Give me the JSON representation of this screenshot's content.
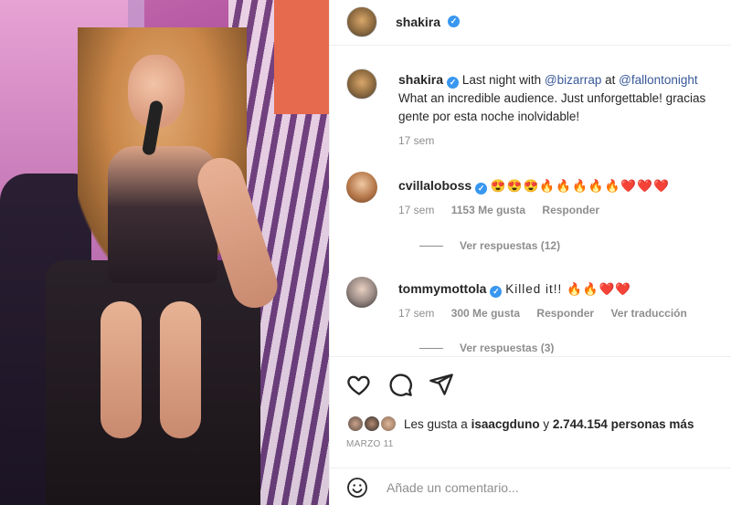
{
  "post": {
    "author": "shakira",
    "verified_mark": "✓"
  },
  "caption": {
    "username": "shakira",
    "text_a": "Last night with ",
    "mention_1": "@bizarrap",
    "text_b": " at ",
    "mention_2": "@fallontonight",
    "line2": "What an incredible audience. Just unforgettable! gracias",
    "line3": "gente por esta noche inolvidable!",
    "time": "17 sem"
  },
  "comments": [
    {
      "username": "cvillaloboss",
      "text": "😍😍😍🔥🔥🔥🔥🔥❤️❤️❤️",
      "time": "17 sem",
      "likes": "1153 Me gusta",
      "reply": "Responder",
      "view_replies": "Ver respuestas (12)"
    },
    {
      "username": "tommymottola",
      "text": "Killed it!! 🔥🔥❤️❤️",
      "time": "17 sem",
      "likes": "300 Me gusta",
      "reply": "Responder",
      "translate": "Ver traducción",
      "view_replies": "Ver respuestas (3)"
    }
  ],
  "likes": {
    "prefix": "Les gusta a ",
    "user": "isaacgduno",
    "middle": " y ",
    "count": "2.744.154 personas más"
  },
  "date": "MARZO 11",
  "add_comment": {
    "placeholder": "Añade un comentario..."
  },
  "icons": {
    "like": "heart-icon",
    "comment": "comment-icon",
    "share": "share-icon",
    "emoji": "emoji-icon"
  }
}
